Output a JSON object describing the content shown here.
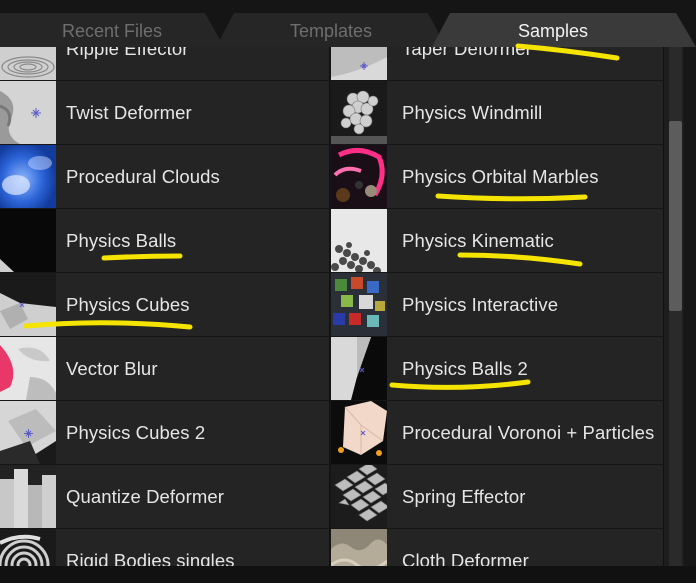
{
  "tabs": [
    {
      "label": "Recent Files",
      "active": false
    },
    {
      "label": "Templates",
      "active": false
    },
    {
      "label": "Samples",
      "active": true
    }
  ],
  "rows": [
    {
      "left": {
        "label": "Ripple Effector",
        "thumb": "ripple"
      },
      "right": {
        "label": "Taper Deformer",
        "thumb": "taper"
      }
    },
    {
      "left": {
        "label": "Twist Deformer",
        "thumb": "twist"
      },
      "right": {
        "label": "Physics Windmill",
        "thumb": "windmill"
      }
    },
    {
      "left": {
        "label": "Procedural Clouds",
        "thumb": "clouds"
      },
      "right": {
        "label": "Physics Orbital Marbles",
        "thumb": "marbles"
      }
    },
    {
      "left": {
        "label": "Physics Balls",
        "thumb": "balls"
      },
      "right": {
        "label": "Physics Kinematic",
        "thumb": "kinematic"
      }
    },
    {
      "left": {
        "label": "Physics Cubes",
        "thumb": "cubes"
      },
      "right": {
        "label": "Physics Interactive",
        "thumb": "interactive"
      }
    },
    {
      "left": {
        "label": "Vector Blur",
        "thumb": "vectorblur"
      },
      "right": {
        "label": "Physics Balls 2",
        "thumb": "balls2"
      }
    },
    {
      "left": {
        "label": "Physics Cubes 2",
        "thumb": "cubes2"
      },
      "right": {
        "label": "Procedural Voronoi + Particles",
        "thumb": "voronoi"
      }
    },
    {
      "left": {
        "label": "Quantize Deformer",
        "thumb": "quantize"
      },
      "right": {
        "label": "Spring Effector",
        "thumb": "spring"
      }
    },
    {
      "left": {
        "label": "Rigid Bodies singles",
        "thumb": "rigid"
      },
      "right": {
        "label": "Cloth Deformer",
        "thumb": "cloth"
      }
    }
  ],
  "colors": {
    "highlight": "#f5e400",
    "background": "#242424",
    "text": "#e6e6e6",
    "active_tab": "#3a3a3a"
  }
}
